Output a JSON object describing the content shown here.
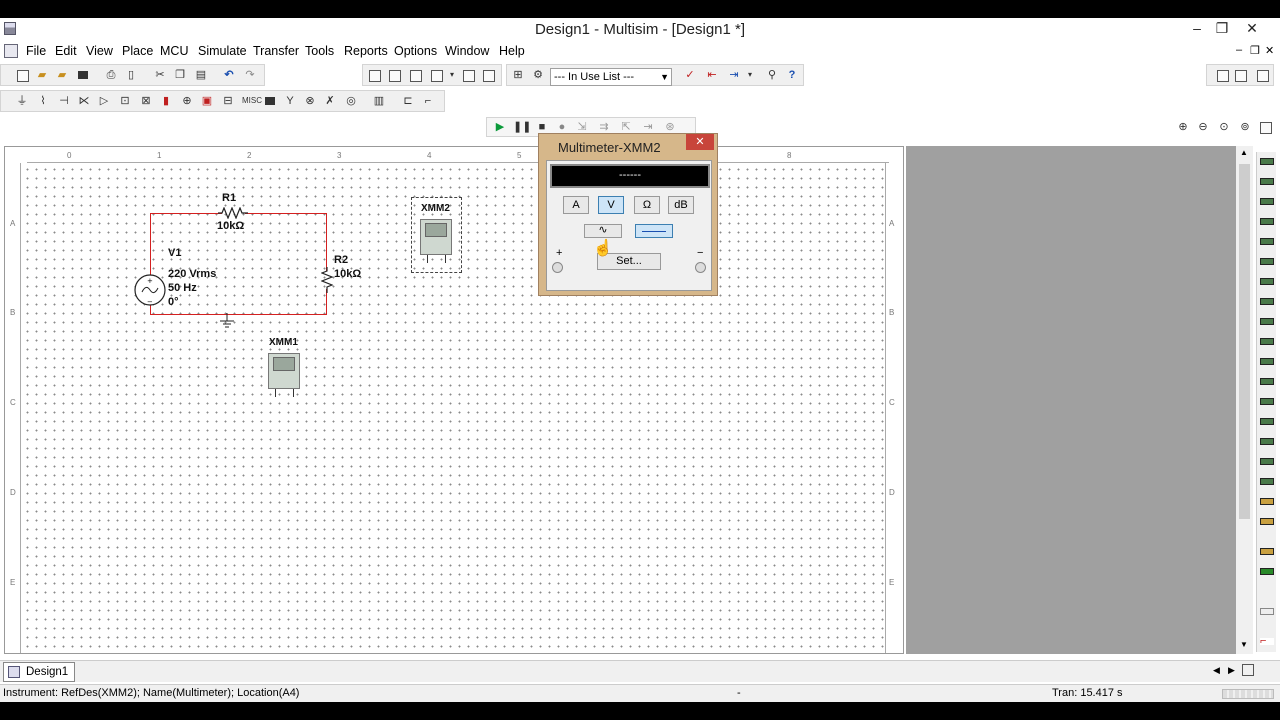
{
  "window": {
    "title": "Design1 - Multisim - [Design1 *]"
  },
  "menu": [
    "File",
    "Edit",
    "View",
    "Place",
    "MCU",
    "Simulate",
    "Transfer",
    "Tools",
    "Reports",
    "Options",
    "Window",
    "Help"
  ],
  "toolbar": {
    "in_use_list": "--- In Use List ---"
  },
  "circuit": {
    "r1_ref": "R1",
    "r1_value": "10kΩ",
    "r2_ref": "R2",
    "r2_value": "10kΩ",
    "v1_ref": "V1",
    "v1_amplitude": "220 Vrms",
    "v1_freq": "50 Hz",
    "v1_phase": "0°",
    "xmm1_ref": "XMM1",
    "xmm2_ref": "XMM2"
  },
  "ruler": {
    "top": [
      "0",
      "1",
      "2",
      "3",
      "4",
      "5",
      "8"
    ],
    "left": [
      "A",
      "B",
      "C",
      "D",
      "E"
    ]
  },
  "multimeter": {
    "title": "Multimeter-XMM2",
    "display": "------",
    "modes": [
      "A",
      "V",
      "Ω",
      "dB"
    ],
    "active_mode": "V",
    "plus": "+",
    "minus": "−",
    "set_label": "Set..."
  },
  "tabs": {
    "design_tab": "Design1 *"
  },
  "status": {
    "message": "Instrument: RefDes(XMM2); Name(Multimeter); Location(A4)",
    "separator": "-",
    "tran": "Tran: 15.417 s"
  }
}
